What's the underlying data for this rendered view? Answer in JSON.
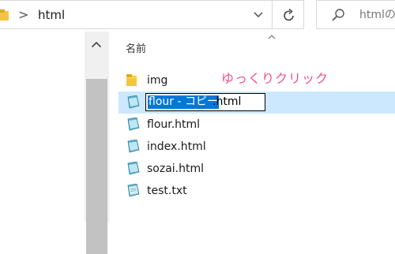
{
  "address_bar": {
    "separator": ">",
    "path": "html"
  },
  "search": {
    "placeholder": "htmlの"
  },
  "list": {
    "column_header": "名前",
    "items": [
      {
        "name": "img",
        "icon": "folder-icon"
      },
      {
        "name": "flour - コピー.html",
        "icon": "html-file-icon",
        "selected": true,
        "renaming": true
      },
      {
        "name": "flour.html",
        "icon": "html-file-icon"
      },
      {
        "name": "index.html",
        "icon": "html-file-icon"
      },
      {
        "name": "sozai.html",
        "icon": "html-file-icon"
      },
      {
        "name": "test.txt",
        "icon": "text-file-icon"
      }
    ]
  },
  "rename_field": {
    "selected_text": "flour - コピー",
    "extension_text": ".html"
  },
  "annotation": {
    "text": "ゆっくりクリック",
    "color": "#f0508c"
  },
  "colors": {
    "selection_background": "#cce8ff",
    "text_highlight": "#0078d7",
    "folder": "#f5c542"
  }
}
